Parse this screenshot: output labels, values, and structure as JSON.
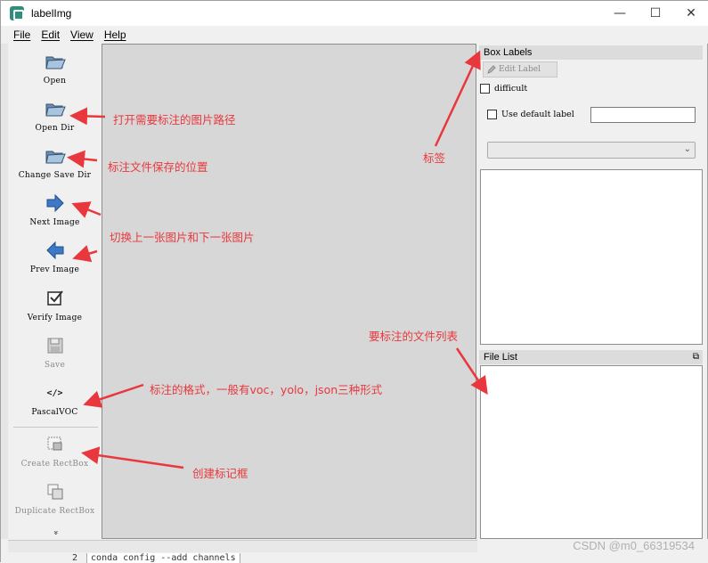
{
  "window": {
    "title": "labelImg",
    "controls": {
      "minimize": "—",
      "maximize": "☐",
      "close": "✕"
    }
  },
  "menubar": [
    "File",
    "Edit",
    "View",
    "Help"
  ],
  "toolbar": [
    {
      "label": "Open",
      "icon": "folder-open-icon",
      "enabled": true
    },
    {
      "label": "Open Dir",
      "icon": "folder-icon",
      "enabled": true
    },
    {
      "label": "Change Save Dir",
      "icon": "folder-icon",
      "enabled": true
    },
    {
      "label": "Next Image",
      "icon": "arrow-right-icon",
      "enabled": true
    },
    {
      "label": "Prev Image",
      "icon": "arrow-left-icon",
      "enabled": true
    },
    {
      "label": "Verify Image",
      "icon": "checkbox-icon",
      "enabled": true
    },
    {
      "label": "Save",
      "icon": "floppy-icon",
      "enabled": false
    },
    {
      "label": "PascalVOC",
      "icon": "code-icon",
      "enabled": true
    },
    {
      "label": "Create RectBox",
      "icon": "create-rectbox-icon",
      "enabled": false
    },
    {
      "label": "Duplicate RectBox",
      "icon": "duplicate-rectbox-icon",
      "enabled": false
    },
    {
      "label": "»",
      "icon": "more-icon",
      "enabled": true
    }
  ],
  "box_labels": {
    "title": "Box Labels",
    "edit_label": "Edit Label",
    "difficult": "difficult",
    "use_default_label": "Use default label",
    "default_label_value": "",
    "combo_value": ""
  },
  "file_list": {
    "title": "File List",
    "float_icon": "⧉"
  },
  "annotations": [
    "打开需要标注的图片路径",
    "标注文件保存的位置",
    "切换上一张图片和下一张图片",
    "标注的格式，一般有voc，yolo，json三种形式",
    "创建标记框",
    "标签",
    "要标注的文件列表"
  ],
  "background": {
    "line_number": "2",
    "command": "conda config --add channels"
  },
  "watermark": "CSDN @m0_66319534",
  "colors": {
    "annotation": "#e8383d",
    "canvas": "#d7d7d7",
    "panel": "#f0f0f0"
  }
}
